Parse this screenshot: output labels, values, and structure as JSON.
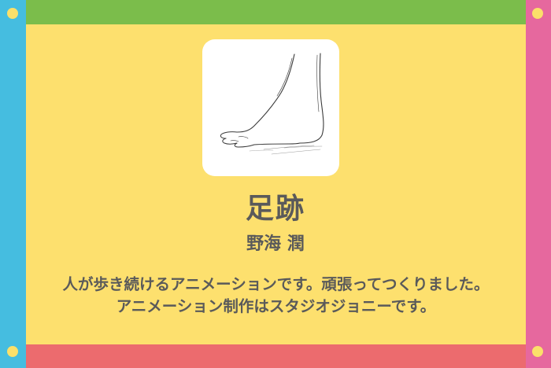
{
  "title": "足跡",
  "author": "野海 潤",
  "description": {
    "line1": "人が歩き続けるアニメーションです。頑張ってつくりました。",
    "line2": "アニメーション制作はスタジオジョニーです。"
  },
  "colors": {
    "background": "#fde06e",
    "top_bar": "#7bbd4b",
    "bottom_bar": "#ec6b6e",
    "left_bar": "#45bde0",
    "right_bar": "#e6689e",
    "text": "#5a5a5a"
  },
  "thumbnail": {
    "icon": "foot-sketch-icon"
  }
}
